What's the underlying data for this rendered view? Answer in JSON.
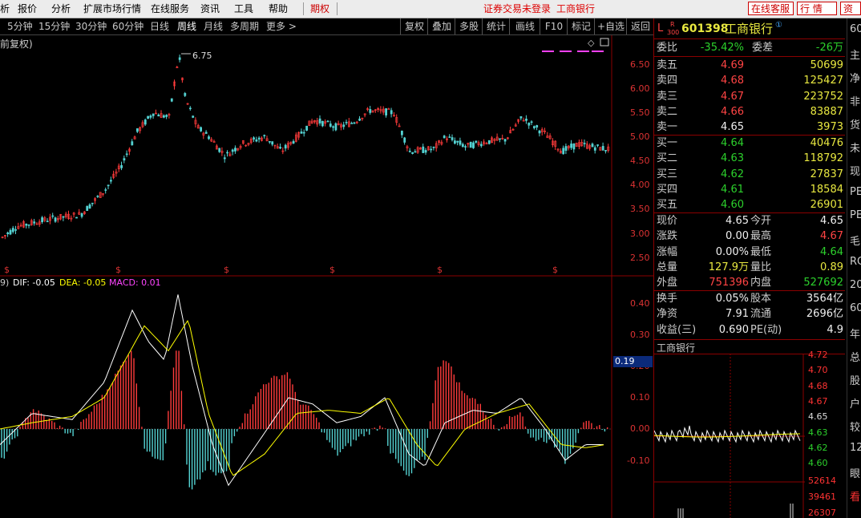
{
  "menu": {
    "items": [
      "析",
      "报价",
      "分析",
      "扩展市场行情",
      "在线服务",
      "资讯",
      "工具",
      "帮助"
    ],
    "futures_tab": "期权",
    "status_warning": "证券交易未登录",
    "stock_name": "工商银行",
    "buttons": [
      "在线客服",
      "行 情",
      "资"
    ]
  },
  "periods": {
    "items": [
      "5分钟",
      "15分钟",
      "30分钟",
      "60分钟",
      "日线",
      "周线",
      "月线",
      "多周期",
      "更多 >"
    ],
    "active": "周线",
    "tools": [
      "复权",
      "叠加",
      "多股",
      "统计",
      "画线",
      "F10",
      "标记",
      "+自选",
      "返回"
    ]
  },
  "chart": {
    "title_fragment": "前复权)",
    "max_label": "6.75",
    "price_ticks": [
      "6.50",
      "6.00",
      "5.50",
      "5.00",
      "4.50",
      "4.00",
      "3.50",
      "3.00",
      "2.50"
    ],
    "dividend_marker": "$",
    "macd_header": {
      "params": "9)",
      "dif": "DIF: -0.05",
      "dea": "DEA: -0.05",
      "macd": "MACD: 0.01"
    },
    "macd_ticks": [
      "0.40",
      "0.30",
      "0.20",
      "0.10",
      "0.00",
      "-0.10"
    ],
    "current_macd_tag": "0.19",
    "colors": {
      "up": "#ff3b3b",
      "down": "#54d2d2",
      "dif": "#ffffff",
      "dea": "#ffff00",
      "macd": "#ff40ff"
    }
  },
  "quote": {
    "code_prefix": "L",
    "badge_top": "R",
    "badge_bottom": "300",
    "code": "601398",
    "name": "工商银行",
    "wei_bi_label": "委比",
    "wei_bi": "-35.42%",
    "wei_cha_label": "委差",
    "wei_cha": "-26万",
    "asks": [
      {
        "label": "卖五",
        "price": "4.69",
        "vol": "50699"
      },
      {
        "label": "卖四",
        "price": "4.68",
        "vol": "125427"
      },
      {
        "label": "卖三",
        "price": "4.67",
        "vol": "223752"
      },
      {
        "label": "卖二",
        "price": "4.66",
        "vol": "83887"
      },
      {
        "label": "卖一",
        "price": "4.65",
        "vol": "3973"
      }
    ],
    "bids": [
      {
        "label": "买一",
        "price": "4.64",
        "vol": "40476"
      },
      {
        "label": "买二",
        "price": "4.63",
        "vol": "118792"
      },
      {
        "label": "买三",
        "price": "4.62",
        "vol": "27837"
      },
      {
        "label": "买四",
        "price": "4.61",
        "vol": "18584"
      },
      {
        "label": "买五",
        "price": "4.60",
        "vol": "26901"
      }
    ],
    "stats": [
      {
        "l1": "现价",
        "v1": "4.65",
        "c1": "white",
        "l2": "今开",
        "v2": "4.65",
        "c2": "white"
      },
      {
        "l1": "涨跌",
        "v1": "0.00",
        "c1": "white",
        "l2": "最高",
        "v2": "4.67",
        "c2": "red"
      },
      {
        "l1": "涨幅",
        "v1": "0.00%",
        "c1": "white",
        "l2": "最低",
        "v2": "4.64",
        "c2": "green"
      },
      {
        "l1": "总量",
        "v1": "127.9万",
        "c1": "yellow",
        "l2": "量比",
        "v2": "0.89",
        "c2": "yellow"
      },
      {
        "l1": "外盘",
        "v1": "751396",
        "c1": "red",
        "l2": "内盘",
        "v2": "527692",
        "c2": "green"
      }
    ],
    "fundamentals": [
      {
        "l1": "换手",
        "v1": "0.05%",
        "l2": "股本",
        "v2": "3564亿"
      },
      {
        "l1": "净资",
        "v1": "7.91",
        "l2": "流通",
        "v2": "2696亿"
      },
      {
        "l1": "收益(三)",
        "v1": "0.690",
        "l2": "PE(动)",
        "v2": "4.9"
      }
    ]
  },
  "mini": {
    "title": "工商银行",
    "price_ticks": [
      "4.72",
      "4.70",
      "4.68",
      "4.67",
      "4.65",
      "4.63",
      "4.62",
      "4.60"
    ],
    "vol_ticks": [
      "52614",
      "39461",
      "26307"
    ]
  },
  "far_right": [
    "60",
    "主",
    "净",
    "非",
    "货",
    "未",
    "现",
    "PE",
    "PE",
    "毛",
    "RO",
    "20",
    "60",
    "年",
    "总",
    "股",
    "户",
    "较",
    "12",
    "眼",
    "看"
  ]
}
